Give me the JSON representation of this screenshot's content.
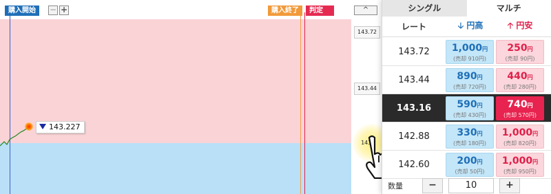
{
  "chart": {
    "start_label": "購入開始",
    "end_label": "購入終了",
    "judge_label": "判定",
    "zoom_out": "−",
    "zoom_in": "+",
    "current_price": "143.227"
  },
  "scale": {
    "up_button": "^",
    "labels": [
      "143.72",
      "143.44",
      "143."
    ]
  },
  "tabs": {
    "single": "シングル",
    "multi": "マルチ"
  },
  "table": {
    "col_rate": "レート",
    "col_up": "円高",
    "col_down": "円安",
    "rows": [
      {
        "rate": "143.72",
        "up_price": "1,000",
        "up_sell": "(売却 910円)",
        "down_price": "250",
        "down_sell": "(売却 90円)"
      },
      {
        "rate": "143.44",
        "up_price": "890",
        "up_sell": "(売却 720円)",
        "down_price": "440",
        "down_sell": "(売却 280円)"
      },
      {
        "rate": "143.16",
        "up_price": "590",
        "up_sell": "(売却 430円)",
        "down_price": "740",
        "down_sell": "(売却 570円)"
      },
      {
        "rate": "142.88",
        "up_price": "330",
        "up_sell": "(売却 180円)",
        "down_price": "1,000",
        "down_sell": "(売却 820円)"
      },
      {
        "rate": "142.60",
        "up_price": "200",
        "up_sell": "(売却 50円)",
        "down_price": "1,000",
        "down_sell": "(売却 950円)"
      }
    ],
    "yen_unit": "円",
    "selected_row": 2
  },
  "quantity": {
    "label": "数量",
    "minus": "−",
    "value": "10",
    "plus": "+"
  },
  "colors": {
    "up": "#1f6fb8",
    "down": "#e0204a",
    "selected_row_bg": "#2a2a2a"
  }
}
